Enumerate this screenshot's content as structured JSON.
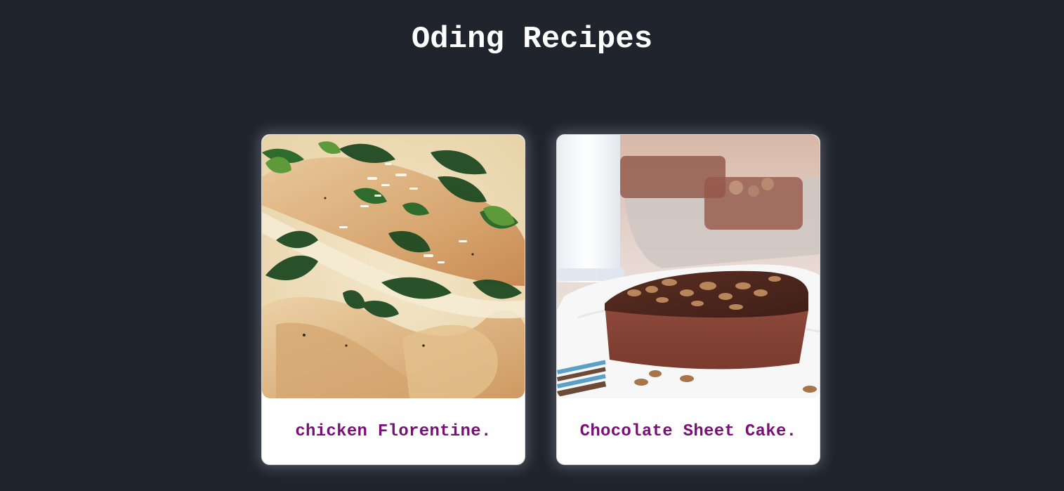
{
  "header": {
    "title": "Oding Recipes"
  },
  "recipes": [
    {
      "title": "chicken Florentine.",
      "image_subject": "chicken florentine with spinach, basil and parmesan in cream sauce"
    },
    {
      "title": "Chocolate Sheet Cake.",
      "image_subject": "chocolate sheet cake square with pecans and a glass of milk"
    }
  ],
  "colors": {
    "background": "#20242c",
    "title_text": "#ffffff",
    "card_title_text": "#7a0f7a",
    "card_background": "#ffffff"
  }
}
